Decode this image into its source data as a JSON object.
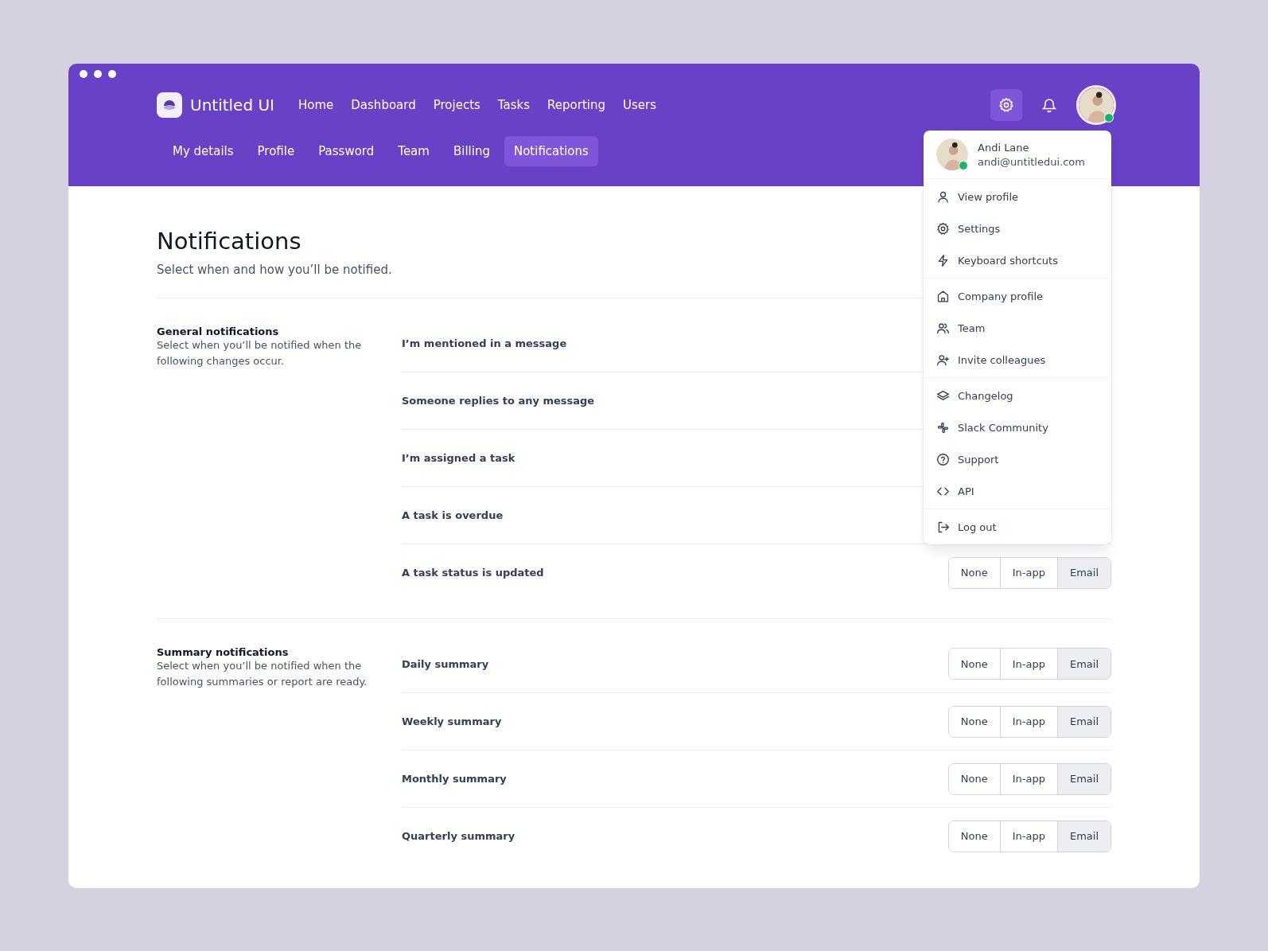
{
  "brand": {
    "name": "Untitled UI"
  },
  "nav": [
    "Home",
    "Dashboard",
    "Projects",
    "Tasks",
    "Reporting",
    "Users"
  ],
  "tabs": [
    {
      "label": "My details",
      "selected": false
    },
    {
      "label": "Profile",
      "selected": false
    },
    {
      "label": "Password",
      "selected": false
    },
    {
      "label": "Team",
      "selected": false
    },
    {
      "label": "Billing",
      "selected": false
    },
    {
      "label": "Notifications",
      "selected": true
    }
  ],
  "header_actions": {
    "settings_selected": true,
    "user_online": true
  },
  "page": {
    "title": "Notifications",
    "subtitle": "Select when and how you’ll be notified."
  },
  "sections": [
    {
      "title": "General notifications",
      "description": "Select when you’ll be notified when the following changes occur.",
      "rows": [
        {
          "label": "I’m mentioned in a message"
        },
        {
          "label": "Someone replies to any message"
        },
        {
          "label": "I’m assigned a task"
        },
        {
          "label": "A task is overdue"
        },
        {
          "label": "A task status is updated",
          "options": [
            {
              "label": "None",
              "selected": false
            },
            {
              "label": "In-app",
              "selected": false
            },
            {
              "label": "Email",
              "selected": true
            }
          ]
        }
      ]
    },
    {
      "title": "Summary notifications",
      "description": "Select when you’ll be notified when the following summaries or report are ready.",
      "rows": [
        {
          "label": "Daily summary",
          "options": [
            {
              "label": "None",
              "selected": false
            },
            {
              "label": "In-app",
              "selected": false
            },
            {
              "label": "Email",
              "selected": true
            }
          ]
        },
        {
          "label": "Weekly summary",
          "options": [
            {
              "label": "None",
              "selected": false
            },
            {
              "label": "In-app",
              "selected": false
            },
            {
              "label": "Email",
              "selected": true
            }
          ]
        },
        {
          "label": "Monthly summary",
          "options": [
            {
              "label": "None",
              "selected": false
            },
            {
              "label": "In-app",
              "selected": false
            },
            {
              "label": "Email",
              "selected": true
            }
          ]
        },
        {
          "label": "Quarterly summary",
          "options": [
            {
              "label": "None",
              "selected": false
            },
            {
              "label": "In-app",
              "selected": false
            },
            {
              "label": "Email",
              "selected": true
            }
          ]
        }
      ]
    }
  ],
  "user_menu": {
    "name": "Andi Lane",
    "email": "andi@untitledui.com",
    "online": true,
    "groups": [
      [
        {
          "kind": "user",
          "label": "View profile"
        },
        {
          "kind": "gear",
          "label": "Settings"
        },
        {
          "kind": "bolt",
          "label": "Keyboard shortcuts"
        }
      ],
      [
        {
          "kind": "home",
          "label": "Company profile"
        },
        {
          "kind": "users",
          "label": "Team"
        },
        {
          "kind": "user-plus",
          "label": "Invite colleagues"
        }
      ],
      [
        {
          "kind": "layers",
          "label": "Changelog"
        },
        {
          "kind": "hash",
          "label": "Slack Community"
        },
        {
          "kind": "help",
          "label": "Support"
        },
        {
          "kind": "code",
          "label": "API"
        }
      ],
      [
        {
          "kind": "logout",
          "label": "Log out"
        }
      ]
    ]
  }
}
